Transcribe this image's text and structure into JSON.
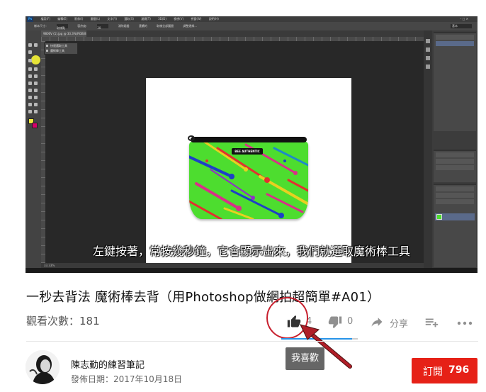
{
  "video": {
    "subtitle": "左鍵按著，常按幾秒鐘，它會顯示出來，我們就選取魔術棒工具",
    "photoshop": {
      "logo": "Ps",
      "menu": [
        "檔案(F)",
        "編輯(E)",
        "影像(I)",
        "圖層(L)",
        "文字(Y)",
        "選取(S)",
        "濾鏡(T)",
        "3D(D)",
        "檢視(V)",
        "視窗(W)",
        "說明(H)"
      ],
      "options": [
        "樣本尺寸：",
        "取樣點",
        "容許度：",
        "30",
        "消除鋸齒",
        "連續的",
        "取樣全部圖層",
        "調整邊緣..."
      ],
      "essentials": "基本",
      "doc_tab": "9800V (1).jpg @ 33.3%(RGB/8)",
      "flyout_items": [
        "快速選取工具",
        "魔術棒工具"
      ],
      "pouch_label": "BEE AUTHENTIC",
      "status": "33.33%"
    }
  },
  "title": "一秒去背法 魔術棒去背（用Photoshop做網拍超簡單#A01）",
  "view_count": "觀看次數：181",
  "actions": {
    "like_count": "4",
    "dislike_count": "0",
    "share_label": "分享",
    "tooltip": "我喜歡",
    "like_icon": "thumbs-up-icon",
    "dislike_icon": "thumbs-down-icon",
    "share_icon": "share-arrow-icon",
    "addto_icon": "playlist-add-icon",
    "more_icon": "more-horizontal-icon"
  },
  "channel": {
    "name": "陳志勤的練習筆記",
    "published": "發佈日期：2017年10月18日",
    "subscribe_label": "訂閱",
    "subscriber_count": "796"
  },
  "colors": {
    "subscribe": "#e62117",
    "annotation_red": "#c71f2d",
    "like_bar": "#2793e8",
    "tooltip_bg": "#666666"
  }
}
